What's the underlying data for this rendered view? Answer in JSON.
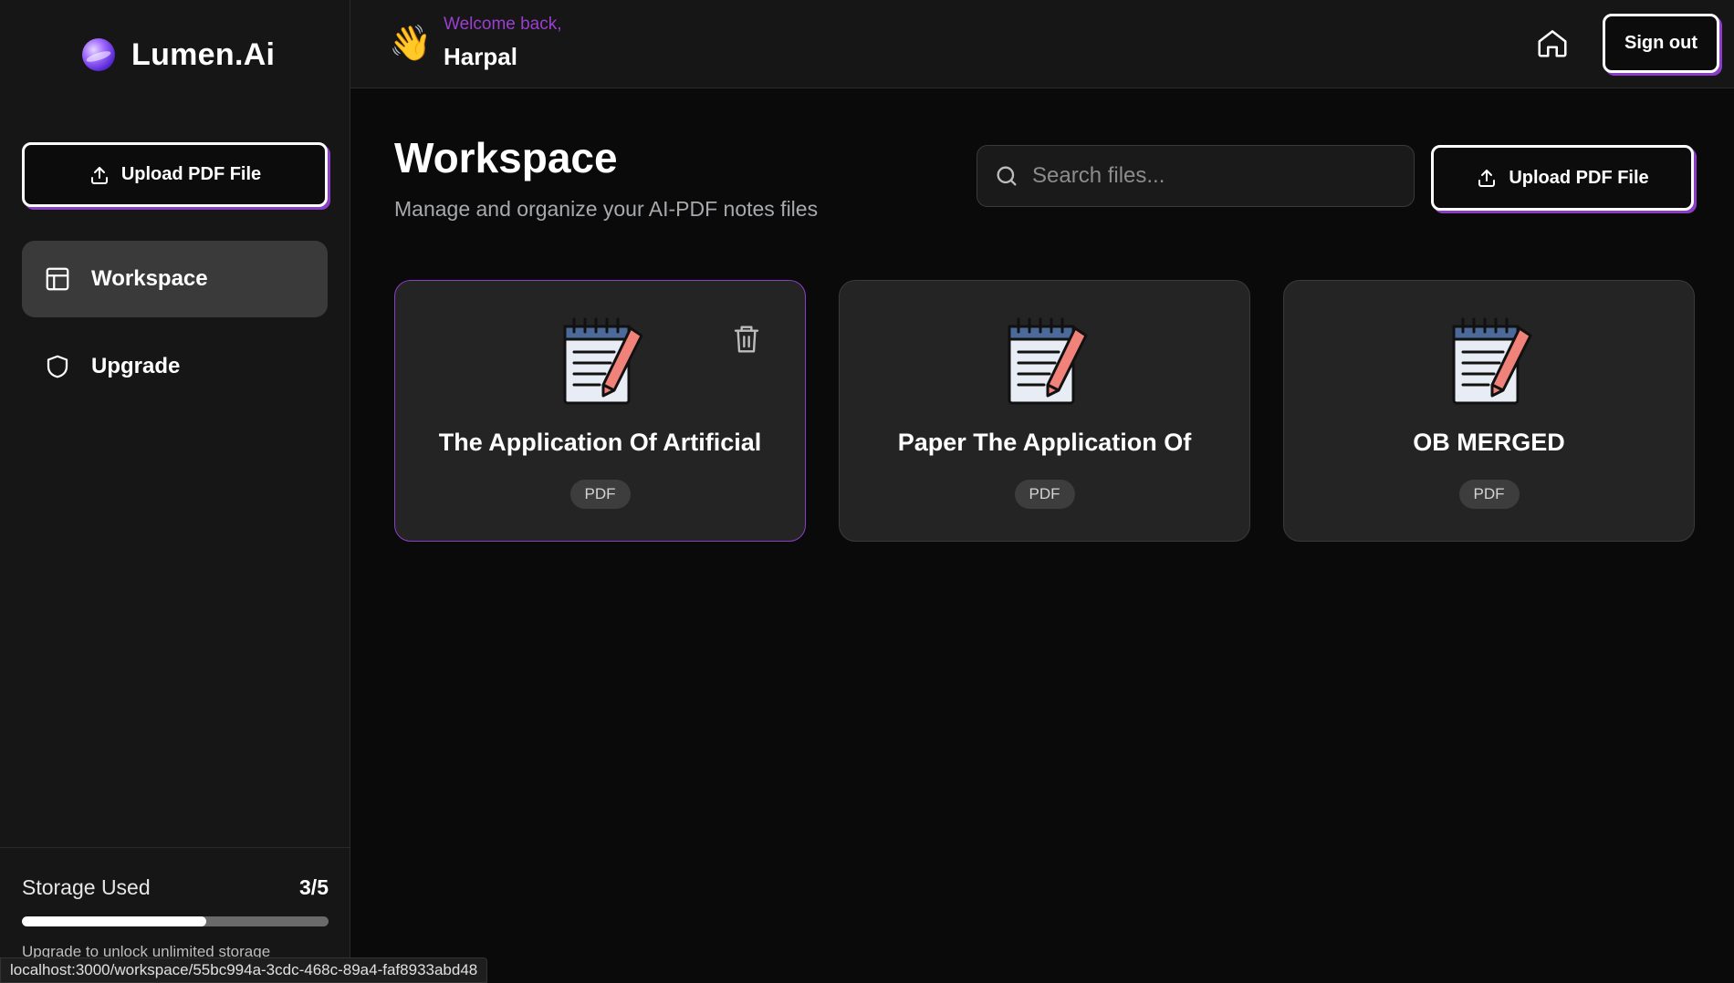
{
  "app": {
    "name": "Lumen.Ai",
    "logo_icon": "lumen-orb-logo"
  },
  "header": {
    "wave_emoji": "👋",
    "welcome_text": "Welcome back,",
    "user_name": "Harpal",
    "home_icon": "home-icon",
    "signout_label": "Sign out"
  },
  "sidebar": {
    "upload_label": "Upload PDF File",
    "items": [
      {
        "label": "Workspace",
        "icon": "layout-icon",
        "active": true
      },
      {
        "label": "Upgrade",
        "icon": "shield-icon",
        "active": false
      }
    ],
    "storage": {
      "label": "Storage Used",
      "count": "3/5",
      "used_fraction": 0.6,
      "hint": "Upgrade to unlock unlimited storage"
    }
  },
  "main": {
    "title": "Workspace",
    "subtitle": "Manage and organize your AI-PDF notes files",
    "search_placeholder": "Search files...",
    "upload_label": "Upload PDF File",
    "files": [
      {
        "title": "The Application Of Artificial",
        "badge": "PDF",
        "selected": true
      },
      {
        "title": "Paper The Application Of",
        "badge": "PDF",
        "selected": false
      },
      {
        "title": "OB MERGED",
        "badge": "PDF",
        "selected": false
      }
    ]
  },
  "status_bar": {
    "url": "localhost:3000/workspace/55bc994a-3cdc-468c-89a4-faf8933abd48"
  },
  "colors": {
    "accent": "#8a3ec7",
    "welcome": "#9b3fd0",
    "background": "#0a0a0a",
    "panel": "#161616",
    "card": "#242424"
  }
}
